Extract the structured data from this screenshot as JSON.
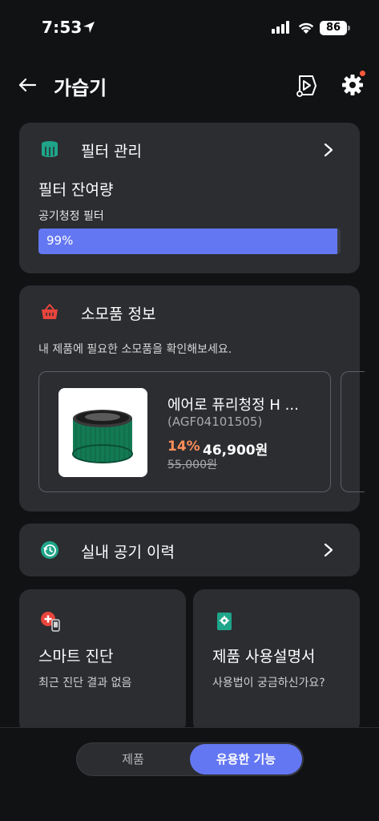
{
  "status_bar": {
    "time": "7:53",
    "battery": "86"
  },
  "header": {
    "title": "가습기"
  },
  "filter_card": {
    "title": "필터 관리",
    "subtitle": "필터 잔여량",
    "filter_name": "공기청정 필터",
    "remaining_percent": 99,
    "remaining_label": "99%"
  },
  "consumables_card": {
    "title": "소모품 정보",
    "description": "내 제품에 필요한 소모품을 확인해보세요.",
    "product": {
      "name": "에어로 퓨리청정 H ...",
      "code": "(AGF04101505)",
      "discount": "14%",
      "price": "46,900원",
      "original_price": "55,000원"
    }
  },
  "air_history": {
    "title": "실내 공기 이력"
  },
  "smart_diagnosis": {
    "title": "스마트 진단",
    "subtitle": "최근 진단 결과 없음"
  },
  "manual": {
    "title": "제품 사용설명서",
    "subtitle": "사용법이 궁금하신가요?"
  },
  "bottom_tabs": {
    "left": "제품",
    "right": "유용한 기능"
  },
  "colors": {
    "accent": "#6477f2",
    "card": "#2b2d31",
    "background": "#111214",
    "discount": "#ff8e5a",
    "teal": "#1fa58a",
    "red": "#e8453c"
  }
}
